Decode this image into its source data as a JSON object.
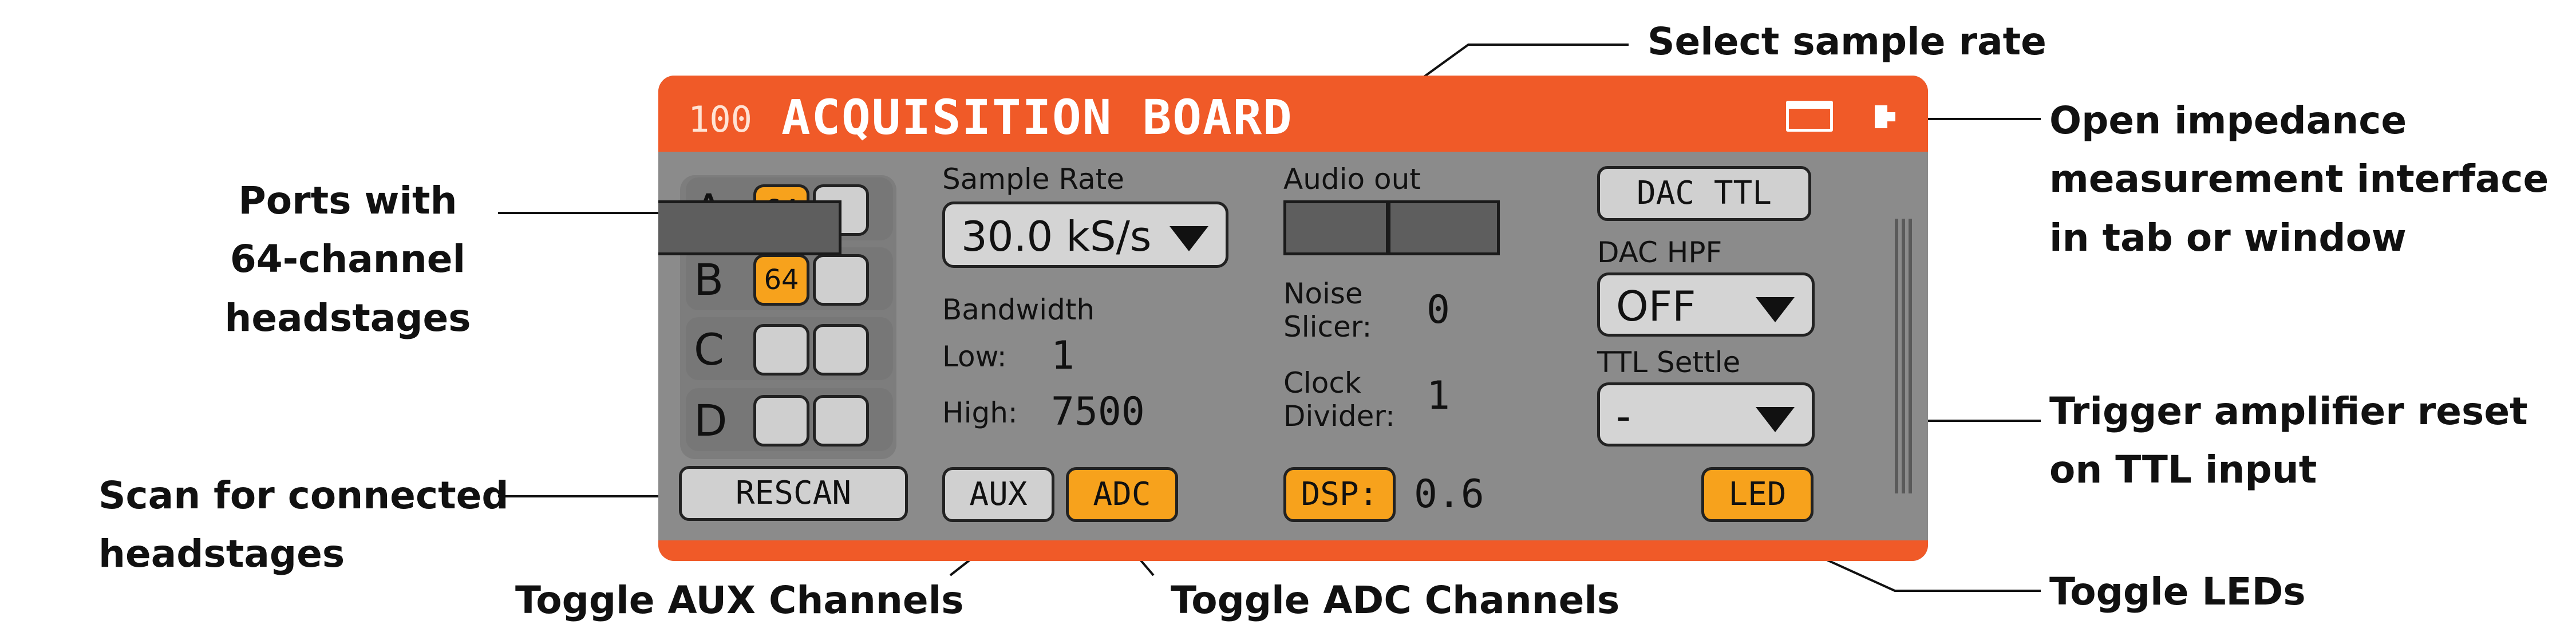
{
  "panel": {
    "id": "100",
    "title": "ACQUISITION BOARD",
    "icons": {
      "window": "window-icon",
      "tab": "tab-icon"
    },
    "colors": {
      "accent": "#f05a28",
      "button_on": "#f7a21c",
      "panel_bg": "#8b8b8b",
      "button_off": "#d0d0d0"
    }
  },
  "ports": [
    {
      "letter": "A",
      "channels": "64"
    },
    {
      "letter": "B",
      "channels": "64"
    },
    {
      "letter": "C",
      "channels": ""
    },
    {
      "letter": "D",
      "channels": ""
    }
  ],
  "rescan_label": "RESCAN",
  "sample_rate": {
    "label": "Sample Rate",
    "value": "30.0 kS/s"
  },
  "bandwidth": {
    "label": "Bandwidth",
    "low_label": "Low:",
    "low_value": "1",
    "high_label": "High:",
    "high_value": "7500"
  },
  "aux_label": "AUX",
  "adc_label": "ADC",
  "audio_out_label": "Audio out",
  "noise_slicer": {
    "label_line1": "Noise",
    "label_line2": "Slicer:",
    "value": "0"
  },
  "clock_divider": {
    "label_line1": "Clock",
    "label_line2": "Divider:",
    "value": "1"
  },
  "dsp": {
    "label": "DSP:",
    "value": "0.6"
  },
  "dac_ttl_label": "DAC TTL",
  "dac_hpf": {
    "label": "DAC HPF",
    "value": "OFF"
  },
  "ttl_settle": {
    "label": "TTL Settle",
    "value": "-"
  },
  "led_label": "LED",
  "annotations": {
    "select_sample_rate": "Select sample rate",
    "ports": [
      "Ports with",
      "64-channel",
      "headstages"
    ],
    "scan": [
      "Scan for connected",
      "headstages"
    ],
    "toggle_aux": "Toggle AUX Channels",
    "toggle_adc": "Toggle ADC Channels",
    "impedance": [
      "Open impedance",
      "measurement interface",
      "in tab or window"
    ],
    "trigger_reset": [
      "Trigger amplifier reset",
      "on TTL input"
    ],
    "toggle_leds": "Toggle LEDs"
  }
}
